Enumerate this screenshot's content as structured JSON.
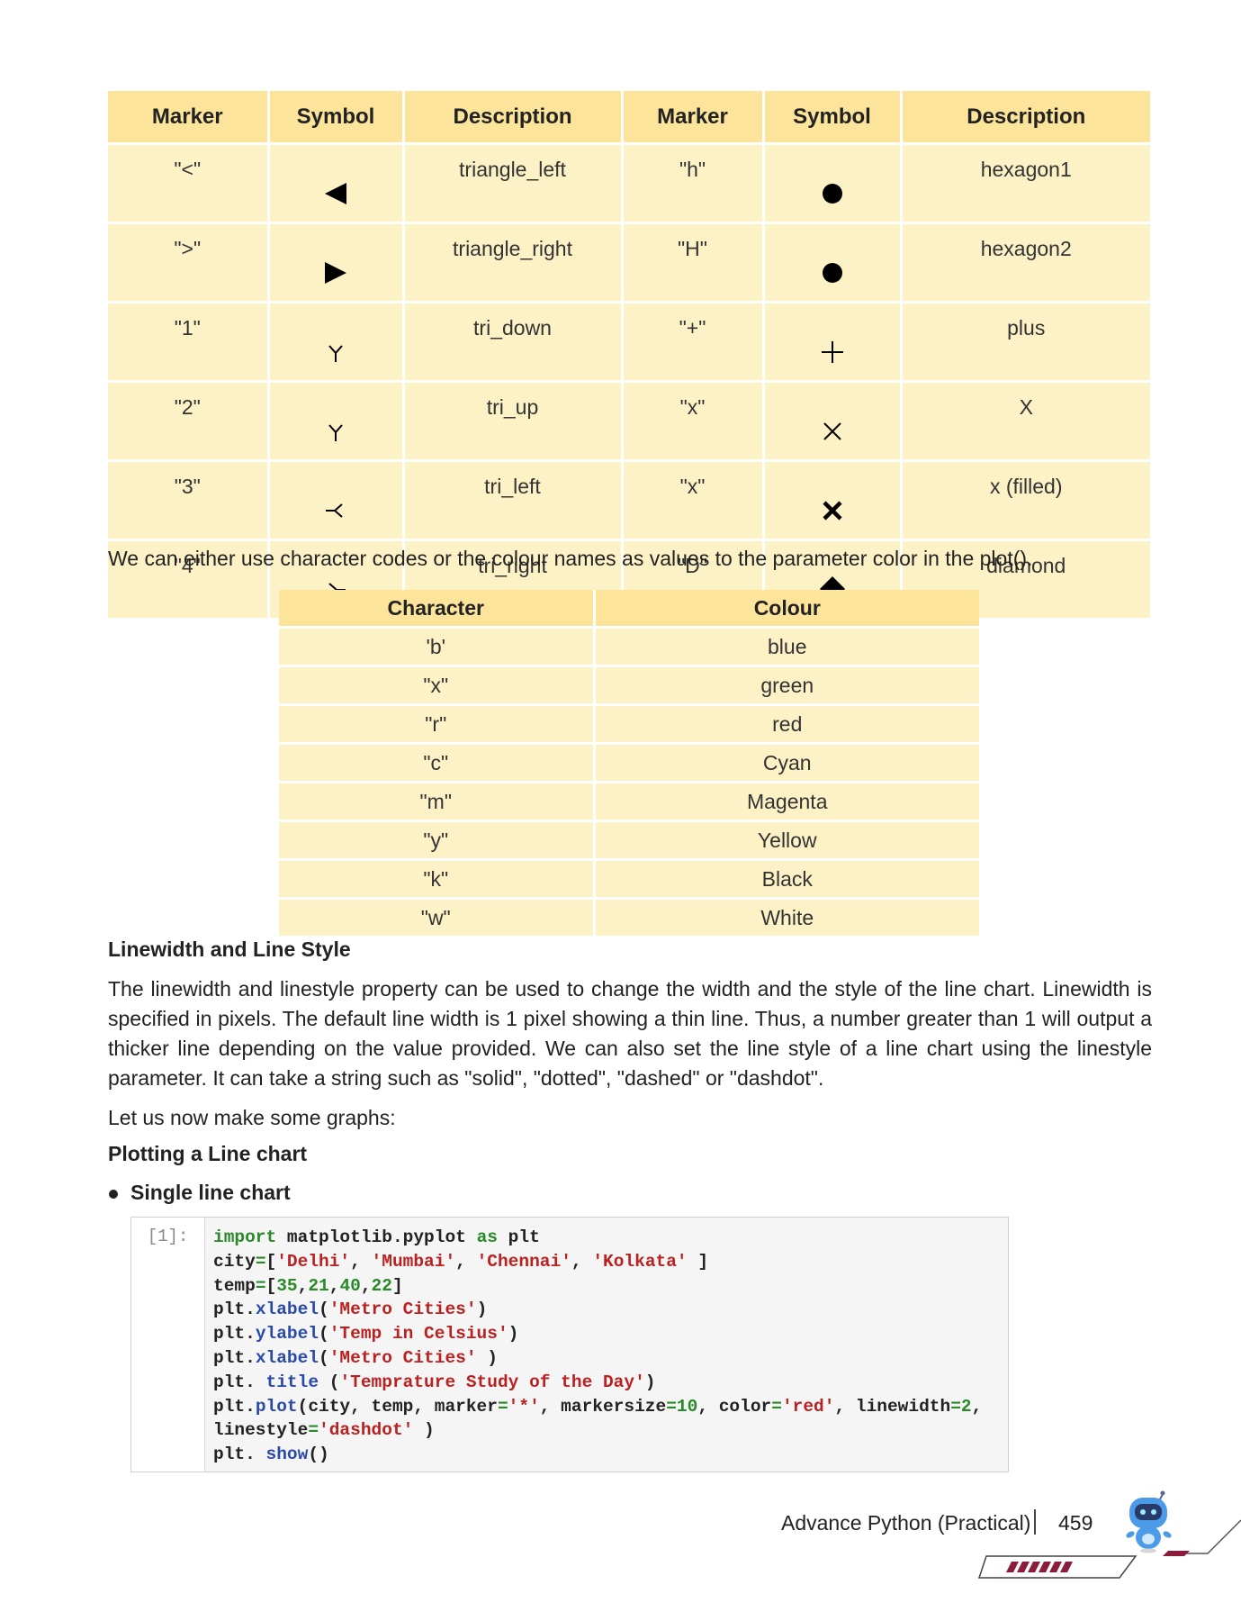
{
  "marker_table": {
    "headers": [
      "Marker",
      "Symbol",
      "Description",
      "Marker",
      "Symbol",
      "Description"
    ],
    "rows": [
      {
        "m1": "\"<\"",
        "sym1": "triangle-left-icon",
        "d1": "triangle_left",
        "m2": "\"h\"",
        "sym2": "hexagon1-icon",
        "d2": "hexagon1"
      },
      {
        "m1": "\">\"",
        "sym1": "triangle-right-icon",
        "d1": "triangle_right",
        "m2": "\"H\"",
        "sym2": "hexagon2-icon",
        "d2": "hexagon2"
      },
      {
        "m1": "\"1\"",
        "sym1": "tri-down-icon",
        "d1": "tri_down",
        "m2": "\"+\"",
        "sym2": "plus-icon",
        "d2": "plus"
      },
      {
        "m1": "\"2\"",
        "sym1": "tri-up-icon",
        "d1": "tri_up",
        "m2": "\"x\"",
        "sym2": "x-icon",
        "d2": "X"
      },
      {
        "m1": "\"3\"",
        "sym1": "tri-left-icon",
        "d1": "tri_left",
        "m2": "\"x\"",
        "sym2": "x-filled-icon",
        "d2": "x (filled)"
      },
      {
        "m1": "\"4\"",
        "sym1": "tri-right-icon",
        "d1": "tri_right",
        "m2": "\"D\"",
        "sym2": "diamond-icon",
        "d2": "diamond"
      }
    ]
  },
  "intro_text": "We can either use character codes or the colour names as values to the parameter color in the plot().",
  "color_table": {
    "headers": [
      "Character",
      "Colour"
    ],
    "rows": [
      [
        "'b'",
        "blue"
      ],
      [
        "\"x\"",
        "green"
      ],
      [
        "\"r\"",
        "red"
      ],
      [
        "\"c\"",
        "Cyan"
      ],
      [
        "\"m\"",
        "Magenta"
      ],
      [
        "\"y\"",
        "Yellow"
      ],
      [
        "\"k\"",
        "Black"
      ],
      [
        "\"w\"",
        "White"
      ]
    ]
  },
  "linewidth_heading": "Linewidth and Line Style",
  "linewidth_text": "The linewidth and linestyle property can be used to change the width and the style of the line chart. Linewidth is specified in pixels. The default line width is 1 pixel showing a thin line. Thus, a number greater than 1 will output a thicker line depending on the value provided. We can also set the line style of a line chart using the linestyle parameter. It can take a string such as \"solid\", \"dotted\", \"dashed\" or \"dashdot\".",
  "graphs_text": "Let us now make some graphs:",
  "plotting_heading": "Plotting a Line chart",
  "bullet_text": "Single line chart",
  "code_prompt": "[1]:",
  "code_lines": [
    [
      [
        "k",
        "import"
      ],
      [
        "",
        " matplotlib.pyplot "
      ],
      [
        "k",
        "as"
      ],
      [
        "",
        " plt"
      ]
    ],
    [
      [
        "",
        "city"
      ],
      [
        "k",
        "="
      ],
      [
        "",
        "["
      ],
      [
        "s",
        "'Delhi'"
      ],
      [
        "",
        ", "
      ],
      [
        "s",
        "'Mumbai'"
      ],
      [
        "",
        ", "
      ],
      [
        "s",
        "'Chennai'"
      ],
      [
        "",
        ", "
      ],
      [
        "s",
        "'Kolkata'"
      ],
      [
        "",
        " ]"
      ]
    ],
    [
      [
        "",
        "temp"
      ],
      [
        "k",
        "="
      ],
      [
        "",
        "["
      ],
      [
        "n",
        "35"
      ],
      [
        "",
        ","
      ],
      [
        "n",
        "21"
      ],
      [
        "",
        ","
      ],
      [
        "n",
        "40"
      ],
      [
        "",
        ","
      ],
      [
        "n",
        "22"
      ],
      [
        "",
        "]"
      ]
    ],
    [
      [
        "",
        "plt."
      ],
      [
        "f",
        "xlabel"
      ],
      [
        "",
        "("
      ],
      [
        "s",
        "'Metro Cities'"
      ],
      [
        "",
        ")"
      ]
    ],
    [
      [
        "",
        "plt."
      ],
      [
        "f",
        "ylabel"
      ],
      [
        "",
        "("
      ],
      [
        "s",
        "'Temp in Celsius'"
      ],
      [
        "",
        ")"
      ]
    ],
    [
      [
        "",
        "plt."
      ],
      [
        "f",
        "xlabel"
      ],
      [
        "",
        "("
      ],
      [
        "s",
        "'Metro Cities' "
      ],
      [
        "",
        ")"
      ]
    ],
    [
      [
        "",
        "plt. "
      ],
      [
        "f",
        "title"
      ],
      [
        "",
        " ("
      ],
      [
        "s",
        "'Temprature Study of the Day'"
      ],
      [
        "",
        ")"
      ]
    ],
    [
      [
        "",
        "plt."
      ],
      [
        "f",
        "plot"
      ],
      [
        "",
        "(city, temp, marker"
      ],
      [
        "k",
        "="
      ],
      [
        "s",
        "'*'"
      ],
      [
        "",
        ", markersize"
      ],
      [
        "k",
        "="
      ],
      [
        "n",
        "10"
      ],
      [
        "",
        ", color"
      ],
      [
        "k",
        "="
      ],
      [
        "s",
        "'red'"
      ],
      [
        "",
        ", linewidth"
      ],
      [
        "k",
        "="
      ],
      [
        "n",
        "2"
      ],
      [
        "",
        ","
      ]
    ],
    [
      [
        "",
        "linestyle"
      ],
      [
        "k",
        "="
      ],
      [
        "s",
        "'dashdot'"
      ],
      [
        "",
        " )"
      ]
    ],
    [
      [
        "",
        "plt. "
      ],
      [
        "f",
        "show"
      ],
      [
        "",
        "()"
      ]
    ]
  ],
  "footer": {
    "title": "Advance Python (Practical)",
    "page_number": "459"
  },
  "colors": {
    "header_bg": "#fce49a",
    "row_bg": "#fdf1c6",
    "code_bg": "#f5f5f5",
    "accent": "#8c1c3c"
  }
}
